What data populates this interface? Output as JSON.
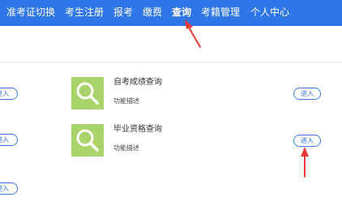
{
  "nav": {
    "items": [
      {
        "label": "准考证切换"
      },
      {
        "label": "考生注册"
      },
      {
        "label": "报考"
      },
      {
        "label": "缴费"
      },
      {
        "label": "查询",
        "active": true
      },
      {
        "label": "考籍管理"
      },
      {
        "label": "个人中心"
      }
    ]
  },
  "services": [
    {
      "title": "自考成绩查询",
      "description": "功能描述",
      "button": "进入"
    },
    {
      "title": "毕业资格查询",
      "description": "功能描述",
      "button": "进入"
    }
  ],
  "left_column": {
    "buttons": [
      "进入",
      "进入",
      "进入"
    ]
  },
  "colors": {
    "nav_background": "#2f76e8",
    "tile_green": "#a9d46b",
    "button_border": "#3a7be0",
    "annotation_arrow": "#e53935"
  },
  "icons": {
    "service_tile": "magnifier-icon",
    "annotation": "arrow-icon"
  }
}
